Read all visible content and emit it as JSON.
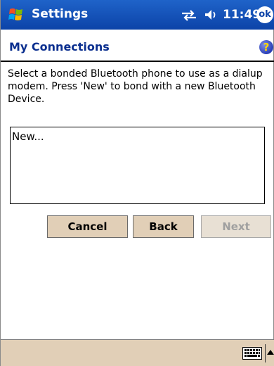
{
  "titlebar": {
    "title": "Settings",
    "clock": "11:49",
    "ok_label": "ok"
  },
  "header": {
    "title": "My Connections",
    "help_label": "?"
  },
  "instructions": "Select a bonded Bluetooth phone to use as a dialup modem. Press 'New' to bond with a new Bluetooth Device.",
  "list": {
    "items": [
      "New..."
    ]
  },
  "buttons": {
    "cancel": "Cancel",
    "back": "Back",
    "next": "Next"
  },
  "colors": {
    "titlebar": "#0c43a8",
    "accent": "#0b2f8f",
    "button_face": "#e1cfb7",
    "disabled_text": "#a0a0a0"
  },
  "icons": {
    "start": "windows-flag-icon",
    "connectivity": "connectivity-icon",
    "volume": "speaker-icon",
    "help": "help-icon",
    "keyboard": "keyboard-icon",
    "sip": "arrow-up-icon"
  }
}
